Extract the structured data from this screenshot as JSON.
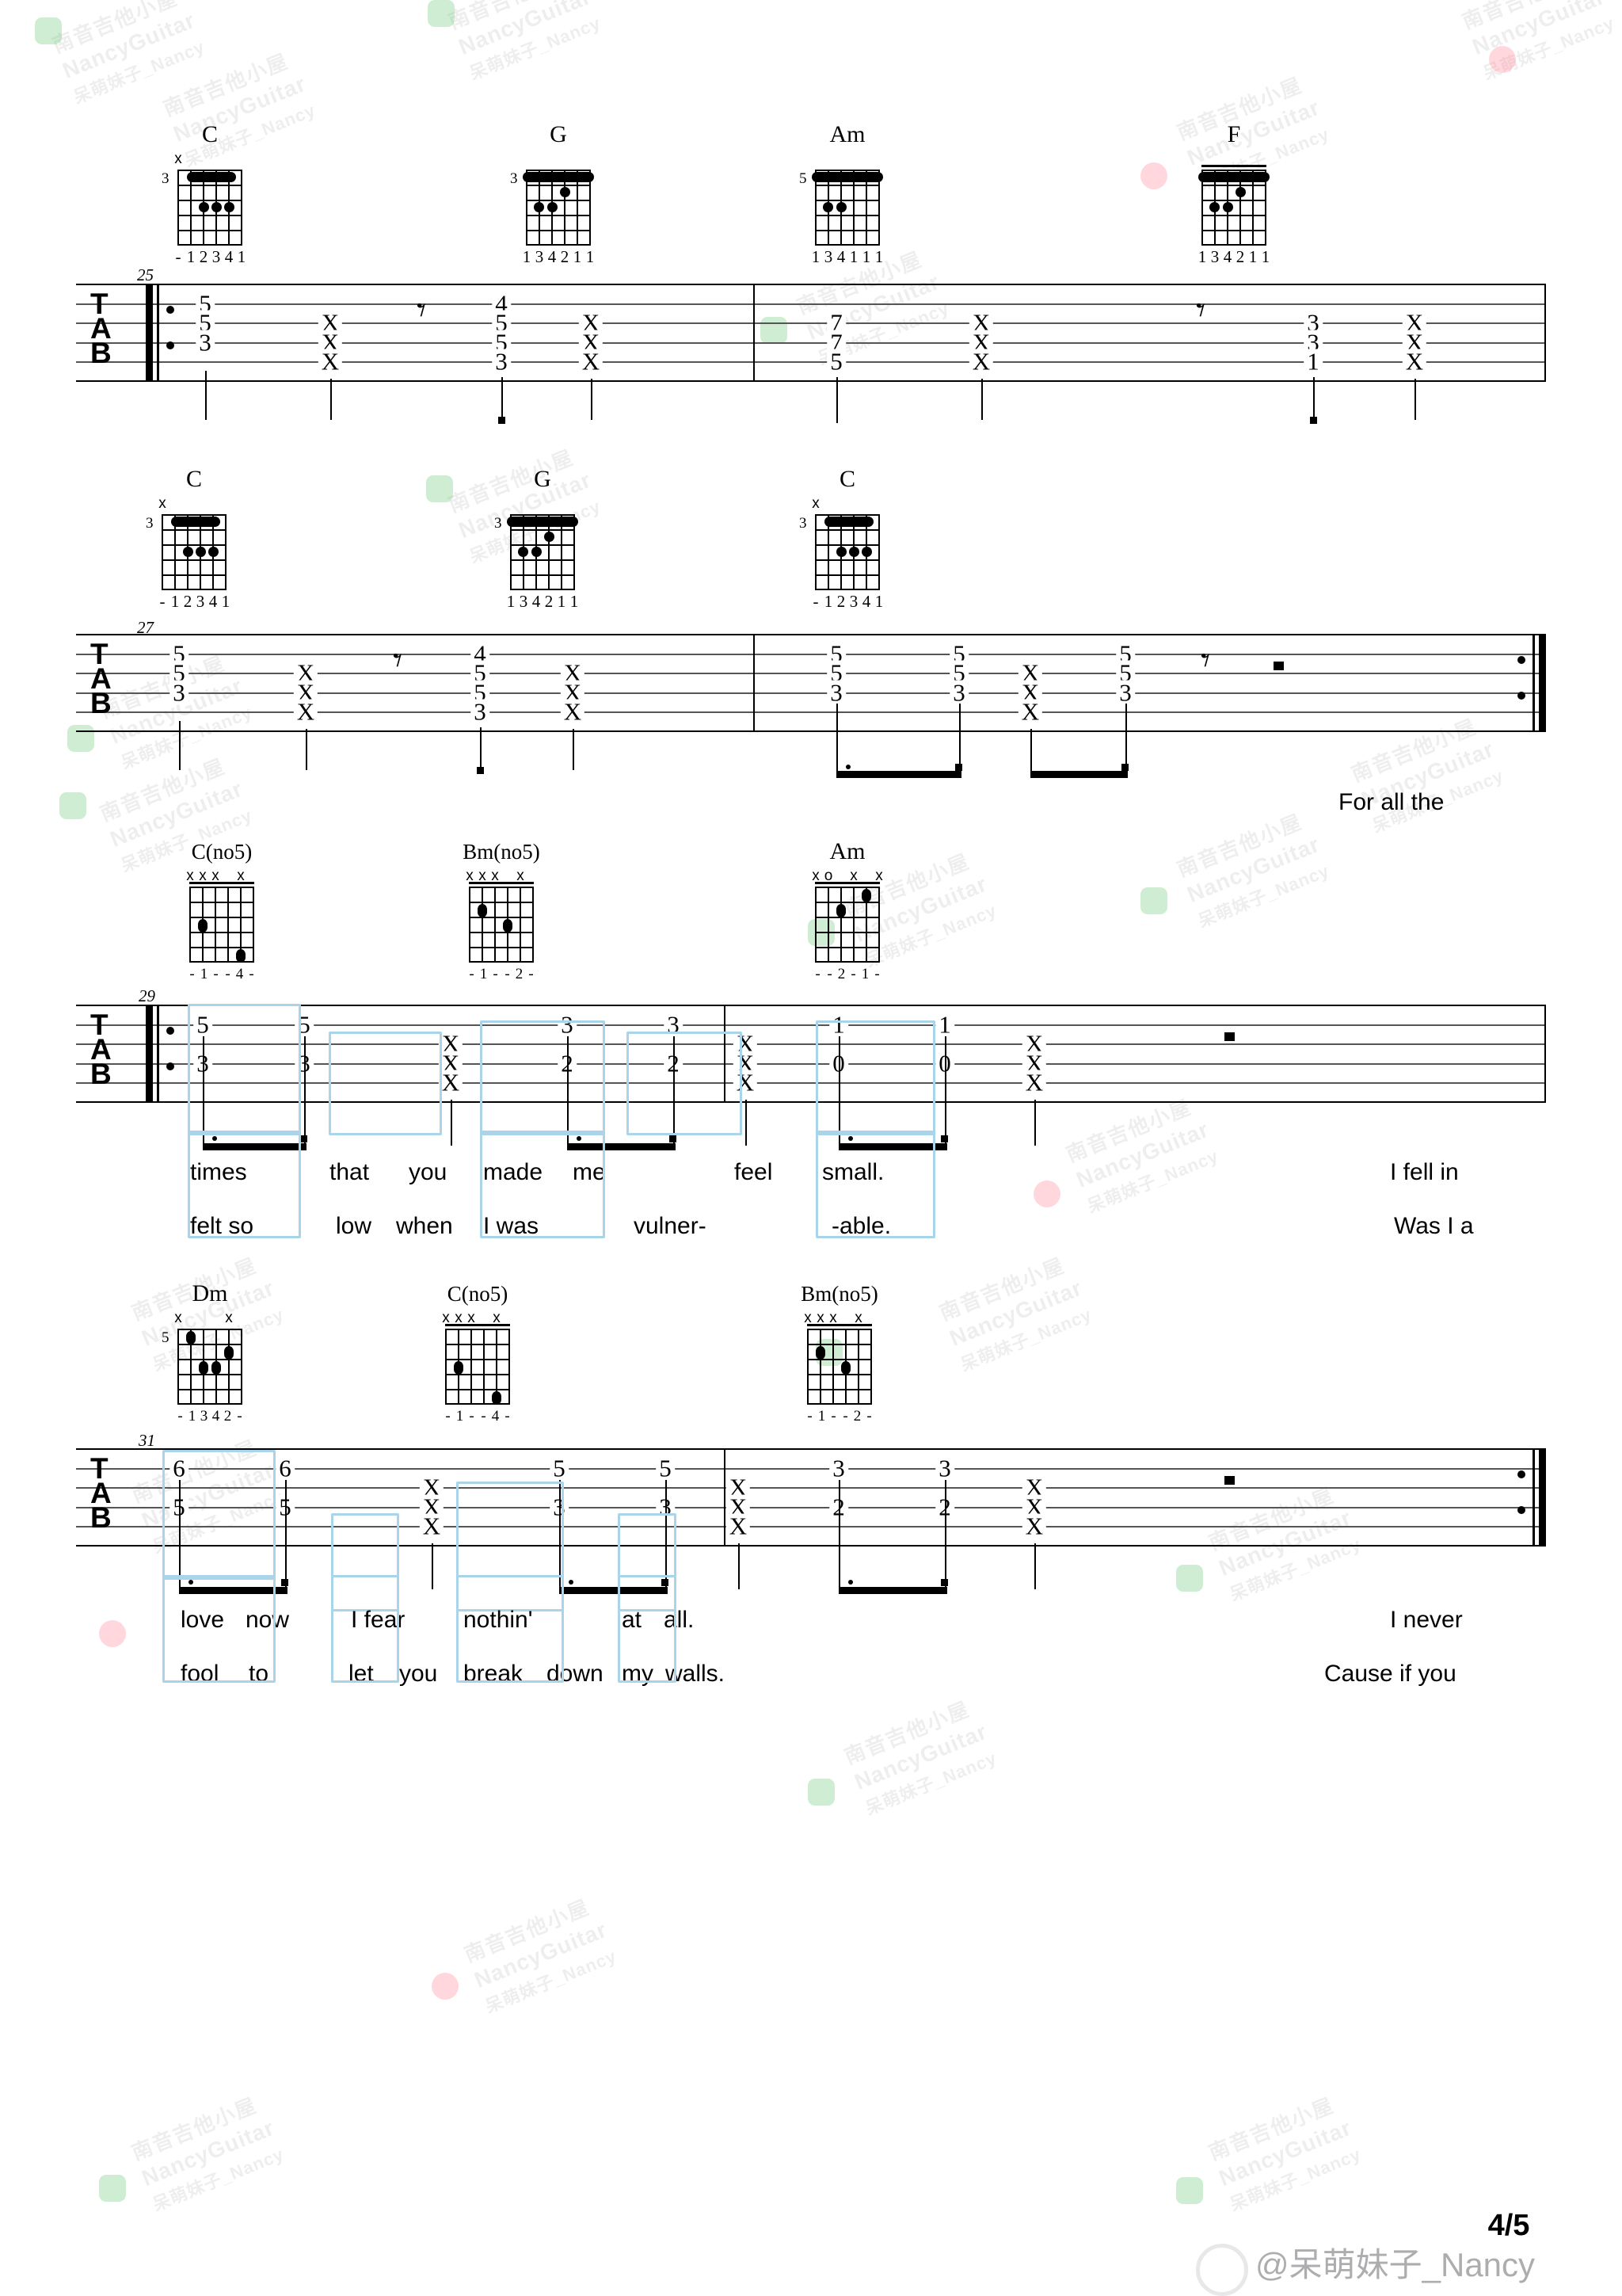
{
  "document": {
    "type": "guitar-tablature",
    "page_label": "4/5",
    "credit": "@呆萌妹子_Nancy",
    "watermark_lines": [
      "南音吉他小屋",
      "NancyGuitar",
      "呆萌妹子_Nancy"
    ]
  },
  "systems": [
    {
      "id": "system-1",
      "measure_number": "25",
      "repeat_start": true,
      "repeat_end": false,
      "chords": [
        {
          "name": "C",
          "base_fret": "3",
          "markers": [
            "x",
            "",
            "",
            "",
            "",
            ""
          ],
          "fingering": [
            "-",
            "1",
            "2",
            "3",
            "4",
            "1"
          ],
          "barre_fret": 1,
          "dots": [
            [
              3,
              3
            ],
            [
              3,
              4
            ],
            [
              3,
              5
            ]
          ],
          "open_nut": false
        },
        {
          "name": "G",
          "base_fret": "3",
          "markers": [
            "",
            "",
            "",
            "",
            "",
            ""
          ],
          "fingering": [
            "1",
            "3",
            "4",
            "2",
            "1",
            "1"
          ],
          "barre_fret": 1,
          "dots": [
            [
              3,
              2
            ],
            [
              3,
              3
            ],
            [
              2,
              4
            ]
          ],
          "open_nut": false
        },
        {
          "name": "Am",
          "base_fret": "5",
          "markers": [
            "",
            "",
            "",
            "",
            "",
            ""
          ],
          "fingering": [
            "1",
            "3",
            "4",
            "1",
            "1",
            "1"
          ],
          "barre_fret": 1,
          "dots": [
            [
              3,
              2
            ],
            [
              3,
              3
            ]
          ],
          "open_nut": false
        },
        {
          "name": "F",
          "base_fret": "",
          "markers": [
            "",
            "",
            "",
            "",
            "",
            ""
          ],
          "fingering": [
            "1",
            "3",
            "4",
            "2",
            "1",
            "1"
          ],
          "barre_fret": 1,
          "dots": [
            [
              3,
              2
            ],
            [
              3,
              3
            ],
            [
              2,
              4
            ]
          ],
          "open_nut": true
        }
      ],
      "tab_columns": [
        {
          "beat": 0,
          "notes": {
            "s2": "5",
            "s3": "5",
            "s4": "3"
          }
        },
        {
          "beat": 1,
          "notes": {
            "s3": "X",
            "s4": "X",
            "s5": "X"
          }
        },
        {
          "beat": 2,
          "rest": "eighth"
        },
        {
          "beat": 3,
          "notes": {
            "s2": "4",
            "s3": "5",
            "s4": "5",
            "s5": "3"
          }
        },
        {
          "beat": 4,
          "notes": {
            "s3": "X",
            "s4": "X",
            "s5": "X"
          }
        },
        {
          "beat": 5,
          "notes": {
            "s3": "7",
            "s4": "7",
            "s5": "5"
          }
        },
        {
          "beat": 6,
          "notes": {
            "s3": "X",
            "s4": "X",
            "s5": "X"
          }
        },
        {
          "beat": 7,
          "rest": "eighth"
        },
        {
          "beat": 8,
          "notes": {
            "s3": "3",
            "s4": "3",
            "s5": "1"
          }
        },
        {
          "beat": 9,
          "notes": {
            "s3": "X",
            "s4": "X",
            "s5": "X"
          }
        }
      ]
    },
    {
      "id": "system-2",
      "measure_number": "27",
      "repeat_start": false,
      "repeat_end": true,
      "chords": [
        {
          "name": "C",
          "base_fret": "3",
          "markers": [
            "x",
            "",
            "",
            "",
            "",
            ""
          ],
          "fingering": [
            "-",
            "1",
            "2",
            "3",
            "4",
            "1"
          ],
          "barre_fret": 1,
          "dots": [
            [
              3,
              3
            ],
            [
              3,
              4
            ],
            [
              3,
              5
            ]
          ],
          "open_nut": false
        },
        {
          "name": "G",
          "base_fret": "3",
          "markers": [
            "",
            "",
            "",
            "",
            "",
            ""
          ],
          "fingering": [
            "1",
            "3",
            "4",
            "2",
            "1",
            "1"
          ],
          "barre_fret": 1,
          "dots": [
            [
              3,
              2
            ],
            [
              3,
              3
            ],
            [
              2,
              4
            ]
          ],
          "open_nut": false
        },
        {
          "name": "C",
          "base_fret": "3",
          "markers": [
            "x",
            "",
            "",
            "",
            "",
            ""
          ],
          "fingering": [
            "-",
            "1",
            "2",
            "3",
            "4",
            "1"
          ],
          "barre_fret": 1,
          "dots": [
            [
              3,
              3
            ],
            [
              3,
              4
            ],
            [
              3,
              5
            ]
          ],
          "open_nut": false
        }
      ],
      "tab_columns": [
        {
          "beat": 0,
          "notes": {
            "s2": "5",
            "s3": "5",
            "s4": "3"
          }
        },
        {
          "beat": 1,
          "notes": {
            "s3": "X",
            "s4": "X",
            "s5": "X"
          }
        },
        {
          "beat": 2,
          "rest": "eighth"
        },
        {
          "beat": 3,
          "notes": {
            "s2": "4",
            "s3": "5",
            "s4": "5",
            "s5": "3"
          }
        },
        {
          "beat": 4,
          "notes": {
            "s3": "X",
            "s4": "X",
            "s5": "X"
          }
        },
        {
          "beat": 5,
          "notes": {
            "s2": "5",
            "s3": "5",
            "s4": "3"
          }
        },
        {
          "beat": 6,
          "notes": {
            "s2": "5",
            "s3": "5",
            "s4": "3"
          }
        },
        {
          "beat": 7,
          "notes": {
            "s3": "X",
            "s4": "X",
            "s5": "X"
          }
        },
        {
          "beat": 8,
          "notes": {
            "s2": "5",
            "s3": "5",
            "s4": "3"
          }
        },
        {
          "beat": 9,
          "rest": "eighth"
        },
        {
          "beat": 10,
          "rest": "square"
        }
      ],
      "pickup_lyric": "For all the"
    },
    {
      "id": "system-3",
      "measure_number": "29",
      "repeat_start": true,
      "repeat_end": false,
      "chords": [
        {
          "name": "C(no5)",
          "base_fret": "",
          "markers": [
            "x",
            "x",
            "x",
            "",
            "x",
            ""
          ],
          "fingering": [
            "-",
            "1",
            "-",
            "-",
            "4",
            "-"
          ],
          "dots_open": [
            [
              3,
              2
            ],
            [
              5,
              5
            ]
          ],
          "open_nut": true
        },
        {
          "name": "Bm(no5)",
          "base_fret": "",
          "markers": [
            "x",
            "x",
            "x",
            "",
            "x",
            ""
          ],
          "fingering": [
            "-",
            "1",
            "-",
            "-",
            "2",
            "-"
          ],
          "dots_open": [
            [
              2,
              2
            ],
            [
              3,
              4
            ]
          ],
          "open_nut": true
        },
        {
          "name": "Am",
          "base_fret": "",
          "markers": [
            "x",
            "o",
            "",
            "x",
            "",
            "x"
          ],
          "fingering": [
            "-",
            "-",
            "2",
            "-",
            "1",
            "-"
          ],
          "dots_open": [
            [
              1,
              5
            ],
            [
              2,
              3
            ]
          ],
          "open_nut": true
        }
      ],
      "tab_columns": [
        {
          "beat": 0,
          "notes": {
            "s2": "5",
            "s4": "3"
          }
        },
        {
          "beat": 1,
          "notes": {
            "s2": "5",
            "s4": "3"
          }
        },
        {
          "beat": 2,
          "notes": {
            "s3": "X",
            "s4": "X",
            "s5": "X"
          }
        },
        {
          "beat": 3,
          "notes": {
            "s2": "3",
            "s4": "2"
          }
        },
        {
          "beat": 4,
          "notes": {
            "s2": "3",
            "s4": "2"
          }
        },
        {
          "beat": 5,
          "notes": {
            "s3": "X",
            "s4": "X",
            "s5": "X"
          }
        },
        {
          "beat": 6,
          "notes": {
            "s2": "1",
            "s4": "0"
          }
        },
        {
          "beat": 7,
          "notes": {
            "s2": "1",
            "s4": "0"
          }
        },
        {
          "beat": 8,
          "notes": {
            "s3": "X",
            "s4": "X",
            "s5": "X"
          }
        },
        {
          "beat": 9,
          "rest": "square"
        }
      ],
      "lyrics_line1": [
        "times",
        "that",
        "you",
        "made",
        "me",
        "feel",
        "small.",
        "I fell in"
      ],
      "lyrics_line2": [
        "felt so",
        "low",
        "when",
        "I was",
        "vulner-",
        "-able.",
        "Was I a"
      ]
    },
    {
      "id": "system-4",
      "measure_number": "31",
      "repeat_start": false,
      "repeat_end": true,
      "chords": [
        {
          "name": "Dm",
          "base_fret": "5",
          "markers": [
            "x",
            "",
            "",
            "",
            "x",
            ""
          ],
          "fingering": [
            "-",
            "1",
            "3",
            "4",
            "2",
            "-"
          ],
          "dots_open": [
            [
              1,
              1
            ],
            [
              2,
              4
            ],
            [
              3,
              2
            ],
            [
              3,
              3
            ]
          ],
          "open_nut": false
        },
        {
          "name": "C(no5)",
          "base_fret": "",
          "markers": [
            "x",
            "x",
            "x",
            "",
            "x",
            ""
          ],
          "fingering": [
            "-",
            "1",
            "-",
            "-",
            "4",
            "-"
          ],
          "dots_open": [
            [
              3,
              2
            ],
            [
              5,
              5
            ]
          ],
          "open_nut": true
        },
        {
          "name": "Bm(no5)",
          "base_fret": "",
          "markers": [
            "x",
            "x",
            "x",
            "",
            "x",
            ""
          ],
          "fingering": [
            "-",
            "1",
            "-",
            "-",
            "2",
            "-"
          ],
          "dots_open": [
            [
              2,
              2
            ],
            [
              3,
              4
            ]
          ],
          "open_nut": true
        }
      ],
      "tab_columns": [
        {
          "beat": 0,
          "notes": {
            "s2": "6",
            "s4": "5"
          }
        },
        {
          "beat": 1,
          "notes": {
            "s2": "6",
            "s4": "5"
          }
        },
        {
          "beat": 2,
          "notes": {
            "s3": "X",
            "s4": "X",
            "s5": "X"
          }
        },
        {
          "beat": 3,
          "notes": {
            "s2": "5",
            "s4": "3"
          }
        },
        {
          "beat": 4,
          "notes": {
            "s2": "5",
            "s4": "3"
          }
        },
        {
          "beat": 5,
          "notes": {
            "s3": "X",
            "s4": "X",
            "s5": "X"
          }
        },
        {
          "beat": 6,
          "notes": {
            "s2": "3",
            "s4": "2"
          }
        },
        {
          "beat": 7,
          "notes": {
            "s2": "3",
            "s4": "2"
          }
        },
        {
          "beat": 8,
          "notes": {
            "s3": "X",
            "s4": "X",
            "s5": "X"
          }
        },
        {
          "beat": 9,
          "rest": "square"
        }
      ],
      "lyrics_line1": [
        "love",
        "now",
        "I fear",
        "nothin'",
        "at",
        "all.",
        "I never"
      ],
      "lyrics_line2": [
        "fool",
        "to",
        "let",
        "you",
        "break",
        "down",
        "my",
        "walls.",
        "Cause if you"
      ]
    }
  ],
  "tab_label_letters": [
    "T",
    "A",
    "B"
  ]
}
